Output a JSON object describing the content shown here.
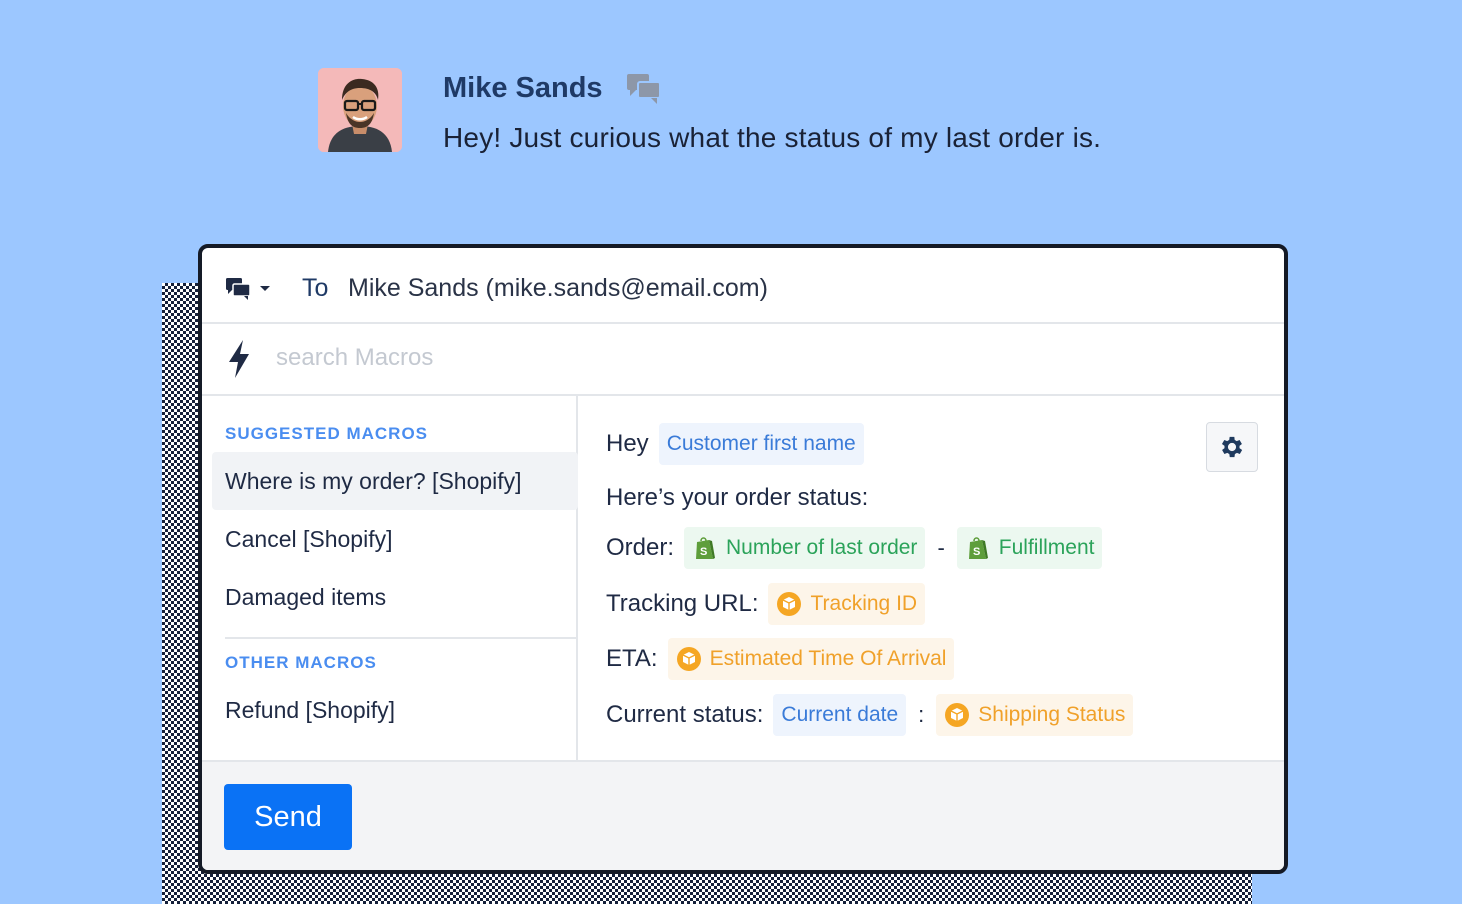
{
  "message": {
    "sender_name": "Mike Sands",
    "text": "Hey! Just curious what the status of my last order is.",
    "icon": "chat-bubbles-icon",
    "avatar": "avatar-photo"
  },
  "composer": {
    "channel_icon": "chat-icon",
    "to_label": "To",
    "to_value": "Mike Sands (mike.sands@email.com)",
    "search_icon": "lightning-icon",
    "search_placeholder": "search Macros",
    "search_value": ""
  },
  "macros": {
    "suggested_title": "SUGGESTED MACROS",
    "suggested": [
      {
        "label": "Where is my order? [Shopify]",
        "active": true
      },
      {
        "label": "Cancel [Shopify]",
        "active": false
      },
      {
        "label": "Damaged items",
        "active": false
      }
    ],
    "other_title": "OTHER MACROS",
    "other": [
      {
        "label": "Refund [Shopify]"
      }
    ]
  },
  "preview": {
    "greeting": "Hey",
    "greeting_var": "Customer first name",
    "status_intro": "Here’s your order status:",
    "order_label": "Order:",
    "order_var": "Number of last order",
    "order_sep": "-",
    "fulfillment_var": "Fulfillment",
    "tracking_label": "Tracking URL:",
    "tracking_var": "Tracking ID",
    "eta_label": "ETA:",
    "eta_var": "Estimated Time Of Arrival",
    "current_label": "Current status:",
    "current_date_var": "Current date",
    "current_sep": ":",
    "shipping_var": "Shipping Status",
    "settings_icon": "gear-icon"
  },
  "footer": {
    "send_label": "Send"
  },
  "colors": {
    "background": "#9cc7ff",
    "accent": "#0a72f5",
    "shopify_green": "#2ba35a",
    "shipping_orange": "#f0a12a",
    "variable_blue": "#3a7bd8"
  }
}
